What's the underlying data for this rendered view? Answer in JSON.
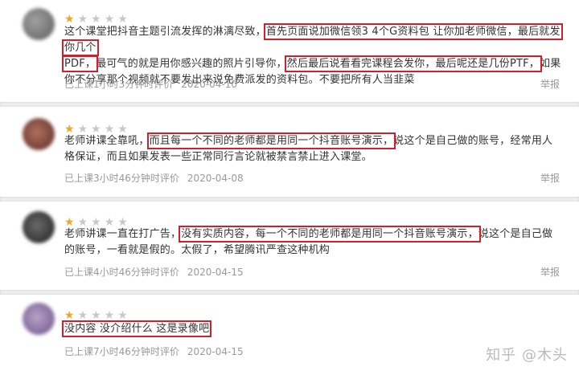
{
  "reviews": [
    {
      "rating": 1,
      "avatar_color": "#7c7c7c",
      "t1": "这个课堂把抖音主题引流发挥的淋漓尽致，",
      "h1": "首先页面说加微信领3 4个G资料包 让你加老师微信，最后就发你几个",
      "h1b": "PDF，",
      "t2": "最可气的就是用你感兴趣的照片引导你，",
      "h2": "然后最后说看看完课程会发你，最后呢还是几份PTF，",
      "t3": "如果你不分享那个视频就不要发出来说免费派发的资料包。不要把所有人当韭菜",
      "meta": "已上课1小时3分钟时评价",
      "date": "2020-04-10",
      "report": "举报"
    },
    {
      "rating": 1,
      "avatar_color": "#8a4a3a",
      "t1": "老师讲课全靠吼，",
      "h1": "而且每一个不同的老师都是用同一个抖音账号演示，",
      "t2": "说这个是自己做的账号，经常用人格保证，而且如果发表一些正常同行言论就被禁言禁止进入课堂。",
      "meta": "已上课3小时46分钟时评价",
      "date": "2020-04-08",
      "report": "举报"
    },
    {
      "rating": 1,
      "avatar_color": "#3a3a3a",
      "t1": "老师讲课一直在打广告，",
      "h1": "没有实质内容，每一个不同的老师都是用同一个抖音账号演示，",
      "t2": "说这个是自己做的账号，一看就是假的。太假了，希望腾讯严查这种机构",
      "meta": "已上课4小时46分钟时评价",
      "date": "2020-04-15",
      "report": "举报"
    },
    {
      "rating": 1,
      "avatar_color": "#8a6fa0",
      "h1": "没内容 没介绍什么 这是录像吧",
      "meta": "已上课7小时46分钟时评价",
      "date": "2020-04-15",
      "report": ""
    }
  ],
  "watermark": "知乎 @木头"
}
